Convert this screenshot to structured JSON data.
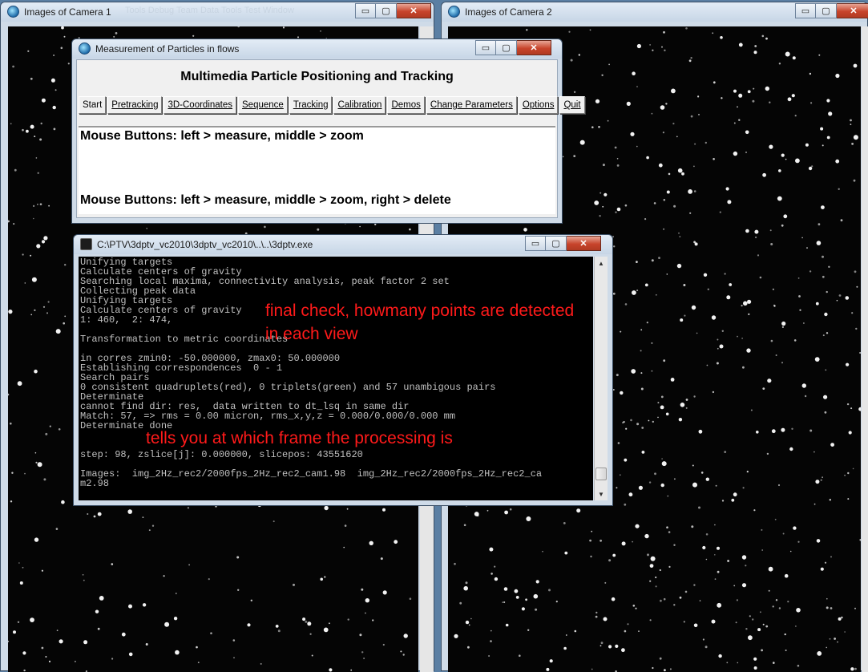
{
  "camera1": {
    "title": "Images of Camera 1",
    "bg_menu": "Tools   Debug   Team   Data   Tools   Test   Window"
  },
  "camera2": {
    "title": "Images of Camera 2"
  },
  "window_buttons": {
    "minimize": "▭",
    "maximize": "▢",
    "close": "✕"
  },
  "dialog": {
    "title": "Measurement of Particles in flows",
    "heading": "Multimedia Particle Positioning and Tracking",
    "menu": [
      "Start",
      "Pretracking",
      "3D-Coordinates",
      "Sequence",
      "Tracking",
      "Calibration",
      "Demos",
      "Change Parameters",
      "Options",
      "Quit"
    ],
    "message1": "Mouse Buttons: left > measure, middle > zoom",
    "message2": "Mouse Buttons: left > measure, middle > zoom, right > delete"
  },
  "console": {
    "title": "C:\\PTV\\3dptv_vc2010\\3dptv_vc2010\\..\\..\\3dptv.exe",
    "lines": [
      "Unifying targets",
      "Calculate centers of gravity",
      "Searching local maxima, connectivity analysis, peak factor 2 set",
      "Collecting peak data",
      "Unifying targets",
      "Calculate centers of gravity",
      "1: 460,  2: 474,",
      "",
      "Transformation to metric coordinates",
      "",
      "in corres zmin0: -50.000000, zmax0: 50.000000",
      "Establishing correspondences  0 - 1",
      "Search pairs",
      "0 consistent quadruplets(red), 0 triplets(green) and 57 unambigous pairs",
      "Determinate",
      "cannot find dir: res,  data written to dt_lsq in same dir",
      "Match: 57, => rms = 0.00 micron, rms_x,y,z = 0.000/0.000/0.000 mm",
      "Determinate done",
      "",
      "",
      "step: 98, zslice[j]: 0.000000, slicepos: 43551620",
      "",
      "Images:  img_2Hz_rec2/2000fps_2Hz_rec2_cam1.98  img_2Hz_rec2/2000fps_2Hz_rec2_ca",
      "m2.98"
    ],
    "scroll_up": "▲",
    "scroll_down": "▼"
  },
  "annotations": {
    "a1_line1": "final check, howmany points are detected",
    "a1_line2": "in each view",
    "a2": "tells you at which frame the processing is"
  },
  "colors": {
    "annotation": "#ff1a1a",
    "console_text": "#c0c0c0",
    "close_button": "#c7442b"
  }
}
